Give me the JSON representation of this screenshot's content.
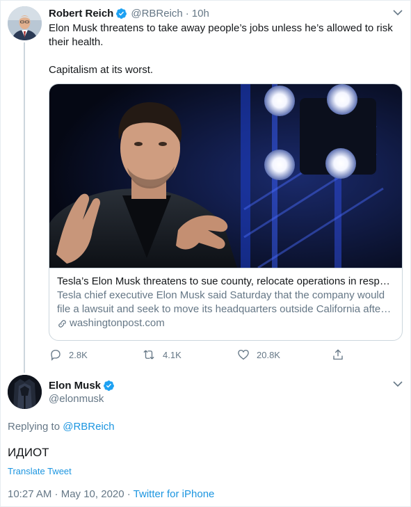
{
  "tweet": {
    "author_name": "Robert Reich",
    "author_handle": "@RBReich",
    "separator": "·",
    "time": "10h",
    "text_line1": "Elon Musk threatens to take away people’s jobs unless he’s allowed to risk their health.",
    "text_line2": "Capitalism at its worst.",
    "card": {
      "title": "Tesla’s Elon Musk threatens to sue county, relocate operations in respon...",
      "description": "Tesla chief executive Elon Musk said Saturday that the company would file a lawsuit and seek to move its headquarters outside California after ...",
      "domain": "washingtonpost.com"
    },
    "stats": {
      "replies": "2.8K",
      "retweets": "4.1K",
      "likes": "20.8K"
    }
  },
  "reply": {
    "author_name": "Elon Musk",
    "author_handle": "@elonmusk",
    "replying_prefix": "Replying to",
    "replying_handle": "@RBReich",
    "text": "ИДИОТ",
    "translate_label": "Translate Tweet",
    "timestamp": "10:27 AM · May 10, 2020 · ",
    "source": "Twitter for iPhone"
  },
  "colors": {
    "accent": "#1b95e0",
    "verified": "#1da1f2",
    "secondary_text": "#657786",
    "border": "#ccd6dd"
  },
  "icons": [
    "verified-badge-icon",
    "chevron-down-icon",
    "link-icon",
    "reply-icon",
    "retweet-icon",
    "like-icon",
    "share-icon"
  ]
}
